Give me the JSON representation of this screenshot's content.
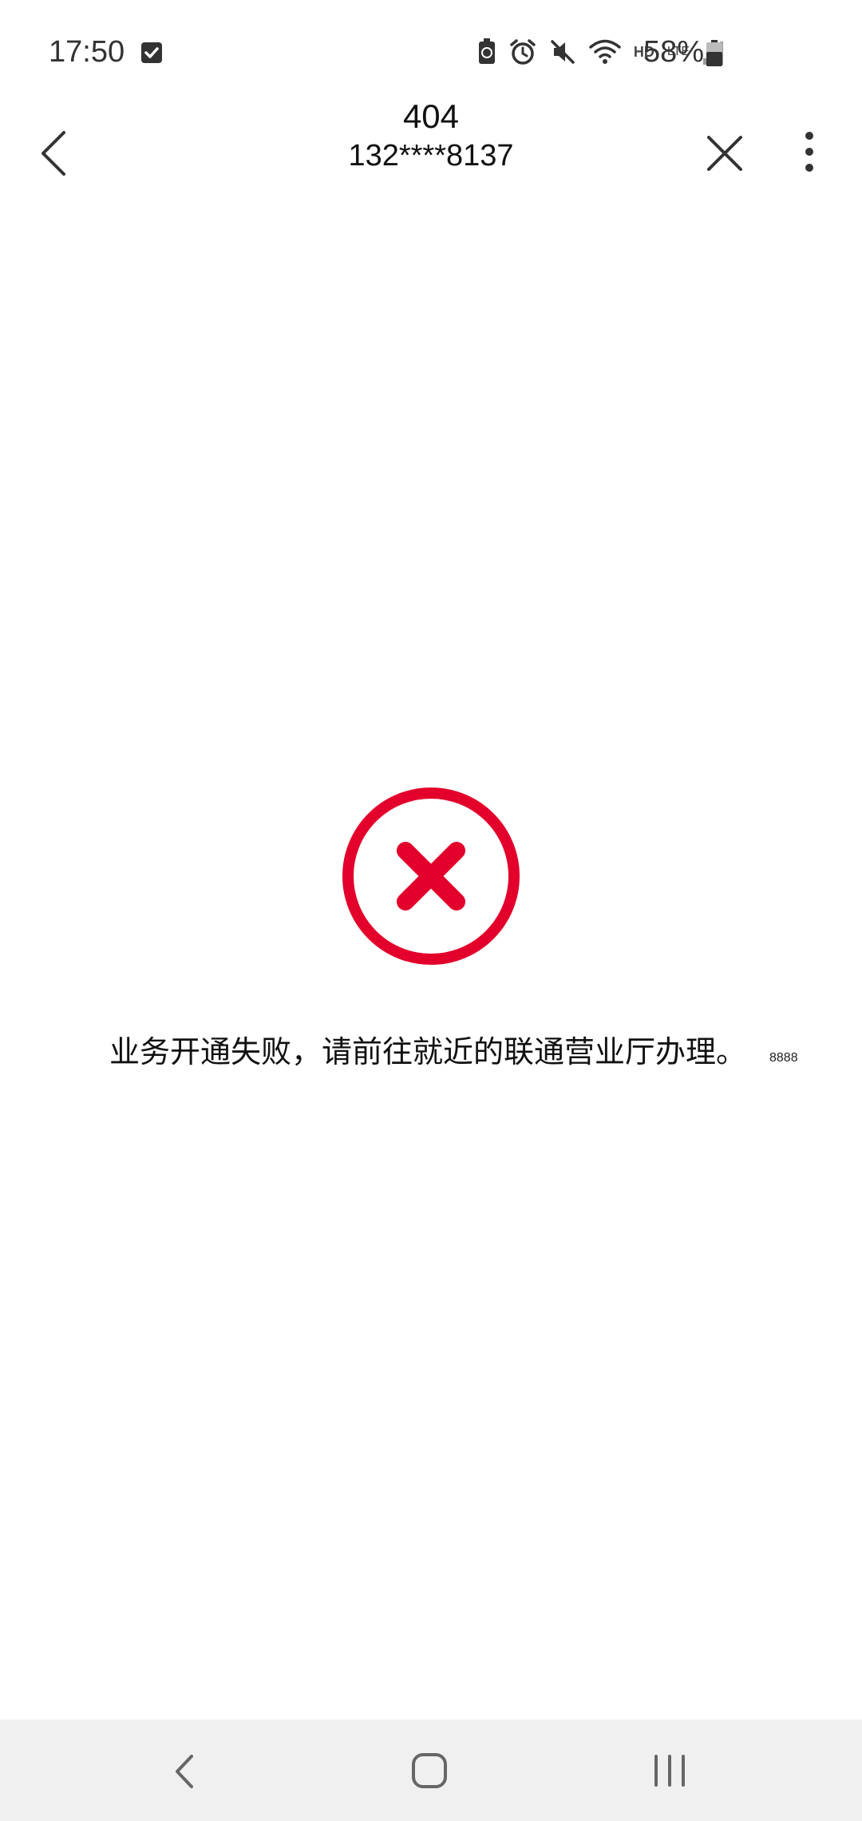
{
  "status_bar": {
    "time": "17:50",
    "battery_percent": "58%",
    "network_hd": "HD",
    "network_lte": "LTE",
    "icons": [
      "checkbox-icon",
      "battery-saver-icon",
      "alarm-icon",
      "mute-icon",
      "wifi-icon",
      "signal-icon",
      "battery-icon"
    ]
  },
  "app_bar": {
    "title": "404",
    "subtitle": "132****8137"
  },
  "content": {
    "message": "业务开通失败，请前往就近的联通营业厅办理。",
    "code": "8888",
    "error_color": "#e3002b"
  },
  "nav_bar": {
    "icons": [
      "nav-back-icon",
      "nav-home-icon",
      "nav-recents-icon"
    ]
  }
}
